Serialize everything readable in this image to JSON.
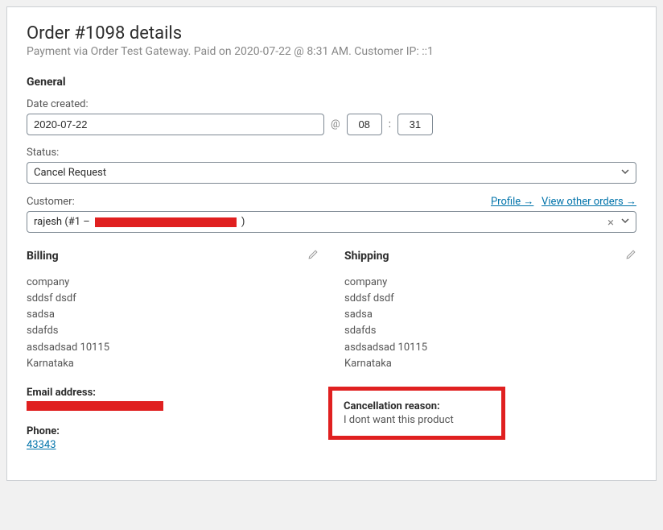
{
  "header": {
    "title": "Order #1098 details",
    "subtitle": "Payment via Order Test Gateway. Paid on 2020-07-22 @ 8:31 AM. Customer IP: ::1"
  },
  "general": {
    "heading": "General",
    "date_label": "Date created:",
    "date_value": "2020-07-22",
    "at_sign": "@",
    "hour_value": "08",
    "colon": ":",
    "minute_value": "31",
    "status_label": "Status:",
    "status_value": "Cancel Request",
    "customer_label": "Customer:",
    "profile_link": "Profile →",
    "other_orders_link": "View other orders →",
    "customer_value_prefix": "rajesh (#1 –",
    "customer_value_suffix": ")",
    "clear_symbol": "×"
  },
  "billing": {
    "heading": "Billing",
    "lines": [
      "company",
      "sddsf dsdf",
      "sadsa",
      "sdafds",
      "asdsadsad 10115",
      "Karnataka"
    ],
    "email_label": "Email address:",
    "phone_label": "Phone:",
    "phone_value": "43343"
  },
  "shipping": {
    "heading": "Shipping",
    "lines": [
      "company",
      "sddsf dsdf",
      "sadsa",
      "sdafds",
      "asdsadsad 10115",
      "Karnataka"
    ],
    "cancel_label": "Cancellation reason:",
    "cancel_value": "I dont want this product"
  }
}
